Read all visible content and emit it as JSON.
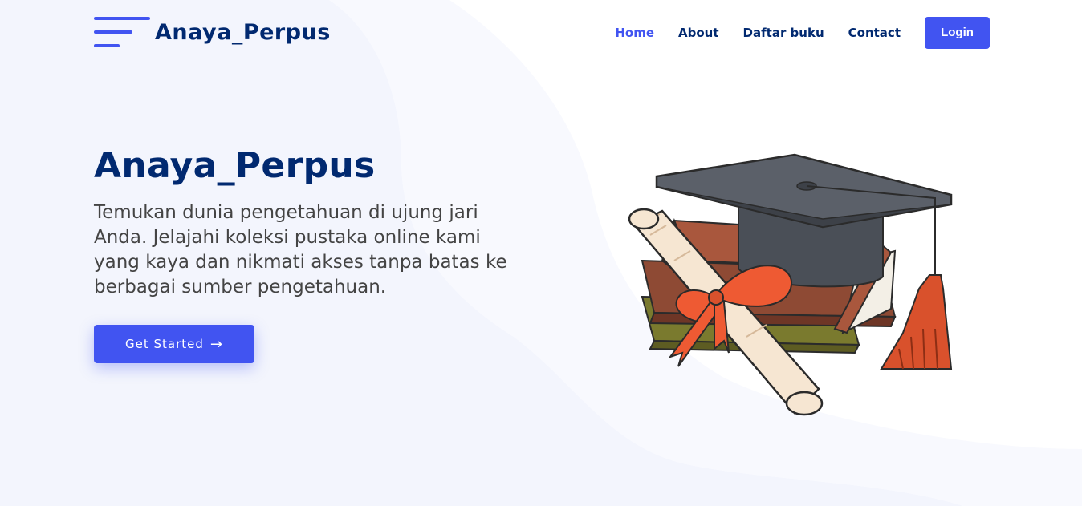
{
  "brand": {
    "name": "Anaya_Perpus"
  },
  "nav": {
    "items": [
      {
        "label": "Home",
        "active": true
      },
      {
        "label": "About"
      },
      {
        "label": "Daftar buku"
      },
      {
        "label": "Contact"
      }
    ],
    "login_label": "Login"
  },
  "hero": {
    "title": "Anaya_Perpus",
    "description": "Temukan dunia pengetahuan di ujung jari Anda. Jelajahi koleksi pustaka online kami yang kaya dan nikmati akses tanpa batas ke berbagai sumber pengetahuan.",
    "cta_label": "Get Started",
    "cta_icon": "arrow-right-icon"
  },
  "colors": {
    "accent": "#4154f1",
    "heading": "#012970",
    "text": "#444444",
    "background_wave": "#f4f6fd"
  }
}
